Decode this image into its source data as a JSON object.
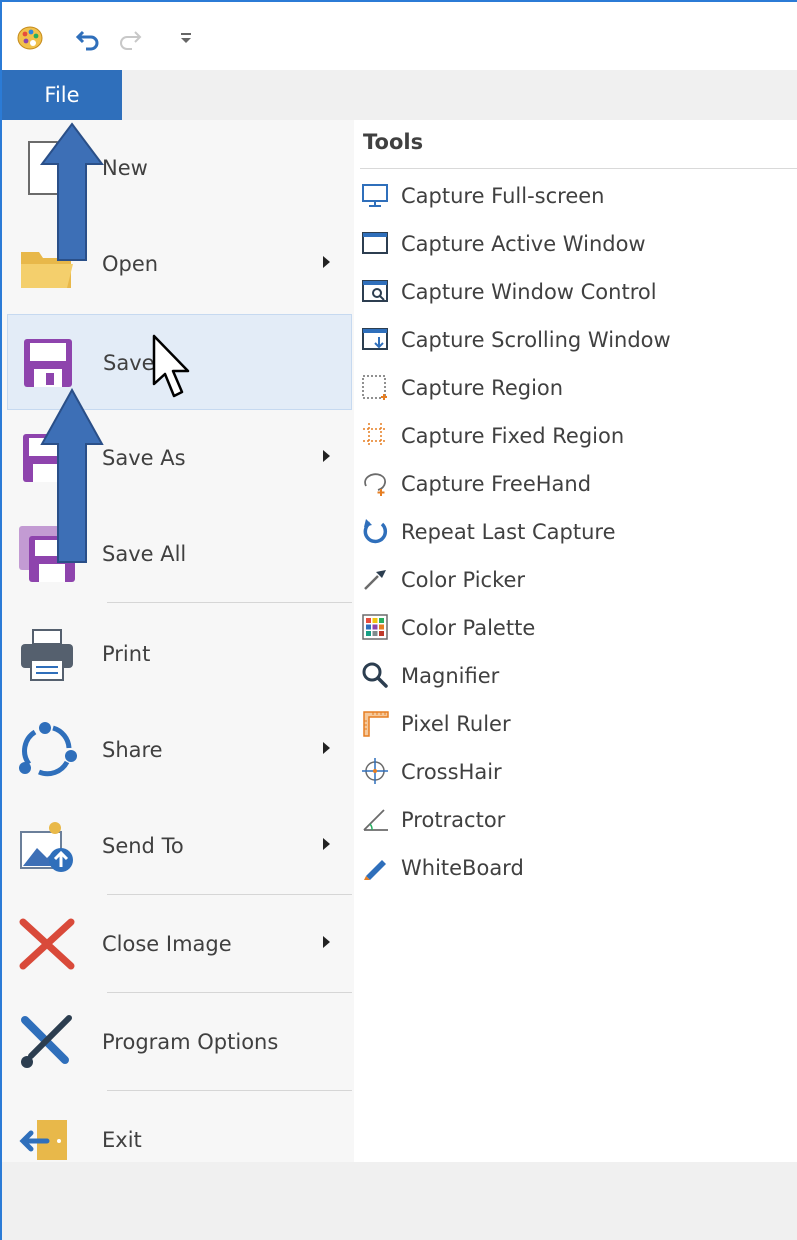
{
  "quick_access": {
    "app_icon": "palette-icon",
    "undo_icon": "undo-icon",
    "redo_icon": "redo-icon",
    "customize_icon": "customize-qat-icon"
  },
  "ribbon": {
    "file_tab_label": "File"
  },
  "backstage_menu": {
    "items": [
      {
        "label": "New",
        "icon": "new-document-icon",
        "has_submenu": false
      },
      {
        "label": "Open",
        "icon": "open-folder-icon",
        "has_submenu": true
      },
      {
        "label": "Save",
        "icon": "save-icon",
        "has_submenu": false,
        "selected": true
      },
      {
        "label": "Save As",
        "icon": "save-as-icon",
        "has_submenu": true
      },
      {
        "label": "Save All",
        "icon": "save-all-icon",
        "has_submenu": false
      },
      {
        "label": "Print",
        "icon": "printer-icon",
        "has_submenu": false
      },
      {
        "label": "Share",
        "icon": "share-icon",
        "has_submenu": true
      },
      {
        "label": "Send To",
        "icon": "send-to-icon",
        "has_submenu": true
      },
      {
        "label": "Close Image",
        "icon": "close-image-icon",
        "has_submenu": true
      },
      {
        "label": "Program Options",
        "icon": "wrench-screwdriver-icon",
        "has_submenu": false
      },
      {
        "label": "Exit",
        "icon": "exit-icon",
        "has_submenu": false
      }
    ]
  },
  "tools_panel": {
    "header": "Tools",
    "items": [
      {
        "label": "Capture Full-screen",
        "icon": "monitor-icon"
      },
      {
        "label": "Capture Active Window",
        "icon": "window-icon"
      },
      {
        "label": "Capture Window Control",
        "icon": "window-control-icon"
      },
      {
        "label": "Capture Scrolling Window",
        "icon": "scrolling-window-icon"
      },
      {
        "label": "Capture Region",
        "icon": "region-icon"
      },
      {
        "label": "Capture Fixed Region",
        "icon": "fixed-region-icon"
      },
      {
        "label": "Capture FreeHand",
        "icon": "freehand-icon"
      },
      {
        "label": "Repeat Last Capture",
        "icon": "repeat-icon"
      },
      {
        "label": "Color Picker",
        "icon": "eyedropper-icon"
      },
      {
        "label": "Color Palette",
        "icon": "color-palette-icon"
      },
      {
        "label": "Magnifier",
        "icon": "magnifier-icon"
      },
      {
        "label": "Pixel Ruler",
        "icon": "pixel-ruler-icon"
      },
      {
        "label": "CrossHair",
        "icon": "crosshair-icon"
      },
      {
        "label": "Protractor",
        "icon": "protractor-icon"
      },
      {
        "label": "WhiteBoard",
        "icon": "whiteboard-pen-icon"
      }
    ]
  },
  "colors": {
    "accent": "#2f6fbb",
    "annotation_arrow": "#3d6fb6",
    "save_purple": "#8e44ad",
    "selected_bg": "#e3ecf7"
  }
}
